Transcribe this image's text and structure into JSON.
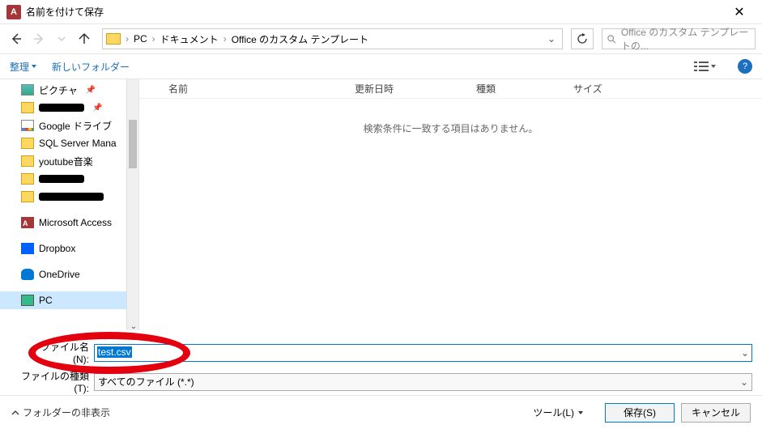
{
  "title": "名前を付けて保存",
  "breadcrumb": {
    "root": "PC",
    "f1": "ドキュメント",
    "f2": "Office のカスタム テンプレート"
  },
  "search": {
    "placeholder": "Office のカスタム テンプレートの..."
  },
  "toolbar": {
    "organize": "整理",
    "newfolder": "新しいフォルダー"
  },
  "sidebar": {
    "items": [
      {
        "label": "ピクチャ"
      },
      {
        "label": ""
      },
      {
        "label": "Google ドライブ"
      },
      {
        "label": "SQL Server Mana"
      },
      {
        "label": "youtube音楽"
      },
      {
        "label": ""
      },
      {
        "label": ""
      },
      {
        "label": "Microsoft Access"
      },
      {
        "label": "Dropbox"
      },
      {
        "label": "OneDrive"
      },
      {
        "label": "PC"
      }
    ]
  },
  "columns": {
    "name": "名前",
    "date": "更新日時",
    "type": "種類",
    "size": "サイズ"
  },
  "empty_message": "検索条件に一致する項目はありません。",
  "filename": {
    "label": "ファイル名(N):",
    "value": "test.csv"
  },
  "filetype": {
    "label": "ファイルの種類(T):",
    "value": "すべてのファイル (*.*)"
  },
  "bottom": {
    "hide": "フォルダーの非表示",
    "tools": "ツール(L)",
    "save": "保存(S)",
    "cancel": "キャンセル"
  }
}
